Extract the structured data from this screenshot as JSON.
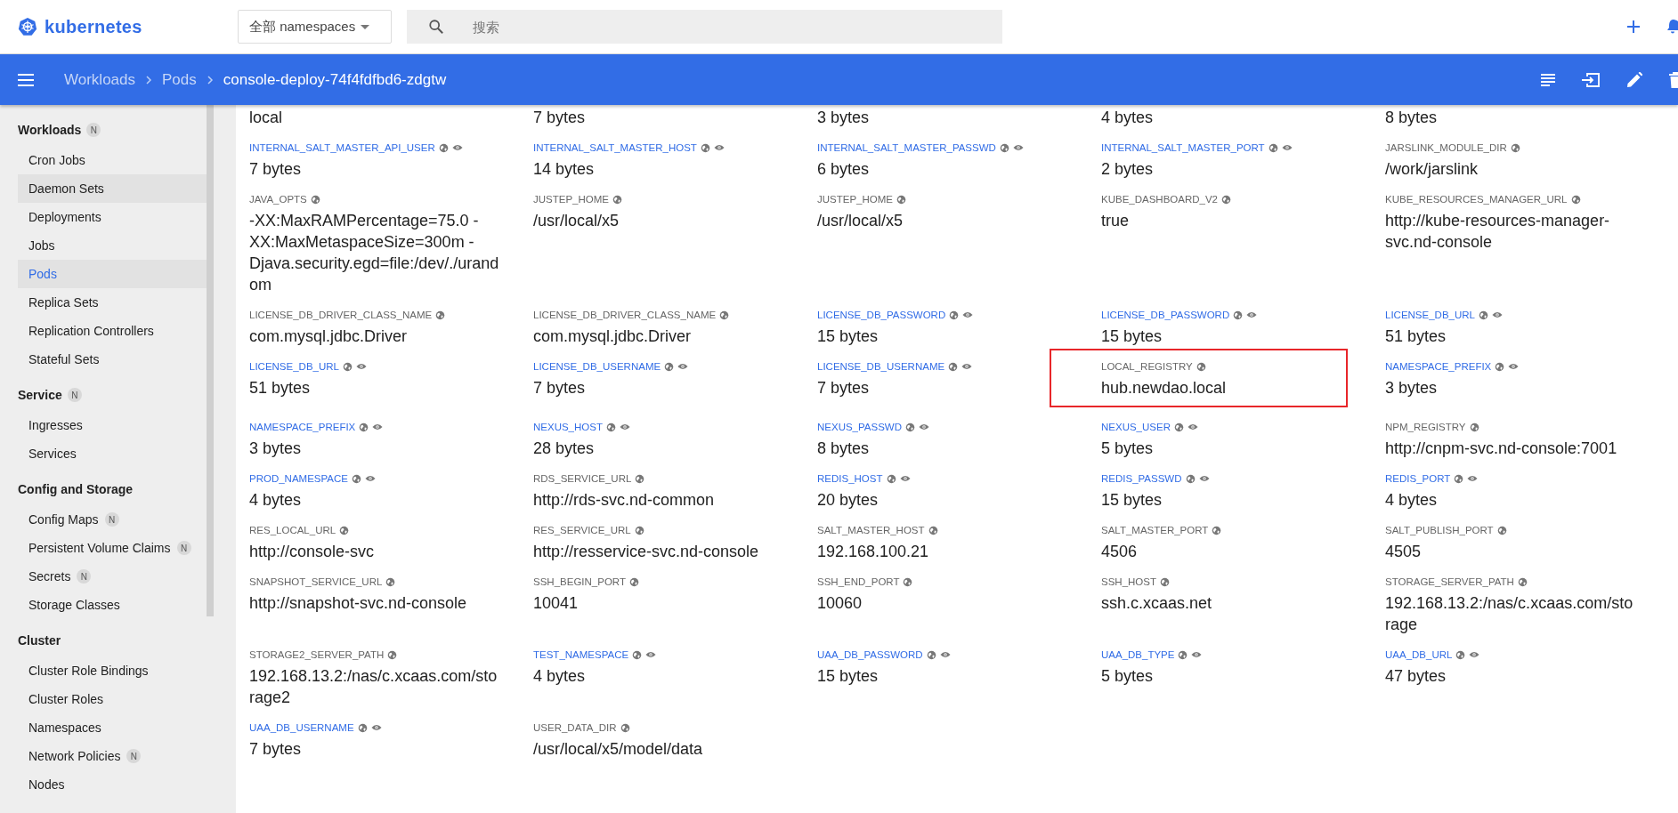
{
  "header": {
    "logo_text": "kubernetes",
    "namespace_select": "全部 namespaces",
    "search": {
      "placeholder": "搜索"
    }
  },
  "action_bar": {
    "breadcrumbs": [
      {
        "label": "Workloads",
        "current": false
      },
      {
        "label": "Pods",
        "current": false
      },
      {
        "label": "console-deploy-74f4fdfbd6-zdgtw",
        "current": true
      }
    ]
  },
  "sidebar": {
    "sections": [
      {
        "title": "Workloads",
        "badge": "N",
        "items": [
          {
            "label": "Cron Jobs",
            "selected": false,
            "hovered": false
          },
          {
            "label": "Daemon Sets",
            "selected": false,
            "hovered": true
          },
          {
            "label": "Deployments",
            "selected": false,
            "hovered": false
          },
          {
            "label": "Jobs",
            "selected": false,
            "hovered": false
          },
          {
            "label": "Pods",
            "selected": true,
            "hovered": false
          },
          {
            "label": "Replica Sets",
            "selected": false,
            "hovered": false
          },
          {
            "label": "Replication Controllers",
            "selected": false,
            "hovered": false
          },
          {
            "label": "Stateful Sets",
            "selected": false,
            "hovered": false
          }
        ]
      },
      {
        "title": "Service",
        "badge": "N",
        "items": [
          {
            "label": "Ingresses",
            "selected": false,
            "hovered": false
          },
          {
            "label": "Services",
            "selected": false,
            "hovered": false
          }
        ]
      },
      {
        "title": "Config and Storage",
        "items": [
          {
            "label": "Config Maps",
            "badge": "N",
            "selected": false,
            "hovered": false
          },
          {
            "label": "Persistent Volume Claims",
            "badge": "N",
            "selected": false,
            "hovered": false
          },
          {
            "label": "Secrets",
            "badge": "N",
            "selected": false,
            "hovered": false
          },
          {
            "label": "Storage Classes",
            "selected": false,
            "hovered": false
          }
        ]
      },
      {
        "title": "Cluster",
        "items": [
          {
            "label": "Cluster Role Bindings",
            "selected": false,
            "hovered": false
          },
          {
            "label": "Cluster Roles",
            "selected": false,
            "hovered": false
          },
          {
            "label": "Namespaces",
            "selected": false,
            "hovered": false
          },
          {
            "label": "Network Policies",
            "badge": "N",
            "selected": false,
            "hovered": false
          },
          {
            "label": "Nodes",
            "selected": false,
            "hovered": false
          }
        ]
      }
    ]
  },
  "env_vars": [
    {
      "value": "local"
    },
    {
      "value": "7 bytes"
    },
    {
      "value": "3 bytes"
    },
    {
      "value": "4 bytes"
    },
    {
      "value": "8 bytes"
    },
    {
      "kind": "secret",
      "key": "INTERNAL_SALT_MASTER_API_USER",
      "value": "7 bytes"
    },
    {
      "kind": "secret",
      "key": "INTERNAL_SALT_MASTER_HOST",
      "value": "14 bytes"
    },
    {
      "kind": "secret",
      "key": "INTERNAL_SALT_MASTER_PASSWD",
      "value": "6 bytes"
    },
    {
      "kind": "secret",
      "key": "INTERNAL_SALT_MASTER_PORT",
      "value": "2 bytes"
    },
    {
      "kind": "config",
      "key": "JARSLINK_MODULE_DIR",
      "value": "/work/jarslink"
    },
    {
      "kind": "config",
      "key": "JAVA_OPTS",
      "value": "-XX:MaxRAMPercentage=75.0 -XX:MaxMetaspaceSize=300m -Djava.security.egd=file:/dev/./urandom"
    },
    {
      "kind": "config",
      "key": "JUSTEP_HOME",
      "value": "/usr/local/x5"
    },
    {
      "kind": "config",
      "key": "JUSTEP_HOME",
      "value": "/usr/local/x5"
    },
    {
      "kind": "config",
      "key": "KUBE_DASHBOARD_V2",
      "value": "true"
    },
    {
      "kind": "config",
      "key": "KUBE_RESOURCES_MANAGER_URL",
      "value": "http://kube-resources-manager-svc.nd-console"
    },
    {
      "kind": "config",
      "key": "LICENSE_DB_DRIVER_CLASS_NAME",
      "value": "com.mysql.jdbc.Driver"
    },
    {
      "kind": "config",
      "key": "LICENSE_DB_DRIVER_CLASS_NAME",
      "value": "com.mysql.jdbc.Driver"
    },
    {
      "kind": "secret",
      "key": "LICENSE_DB_PASSWORD",
      "value": "15 bytes"
    },
    {
      "kind": "secret",
      "key": "LICENSE_DB_PASSWORD",
      "value": "15 bytes"
    },
    {
      "kind": "secret",
      "key": "LICENSE_DB_URL",
      "value": "51 bytes"
    },
    {
      "kind": "secret",
      "key": "LICENSE_DB_URL",
      "value": "51 bytes"
    },
    {
      "kind": "secret",
      "key": "LICENSE_DB_USERNAME",
      "value": "7 bytes"
    },
    {
      "kind": "secret",
      "key": "LICENSE_DB_USERNAME",
      "value": "7 bytes"
    },
    {
      "kind": "config",
      "key": "LOCAL_REGISTRY",
      "value": "hub.newdao.local",
      "highlighted": true
    },
    {
      "kind": "secret",
      "key": "NAMESPACE_PREFIX",
      "value": "3 bytes"
    },
    {
      "kind": "secret",
      "key": "NAMESPACE_PREFIX",
      "value": "3 bytes"
    },
    {
      "kind": "secret",
      "key": "NEXUS_HOST",
      "value": "28 bytes"
    },
    {
      "kind": "secret",
      "key": "NEXUS_PASSWD",
      "value": "8 bytes"
    },
    {
      "kind": "secret",
      "key": "NEXUS_USER",
      "value": "5 bytes"
    },
    {
      "kind": "config",
      "key": "NPM_REGISTRY",
      "value": "http://cnpm-svc.nd-console:7001"
    },
    {
      "kind": "secret",
      "key": "PROD_NAMESPACE",
      "value": "4 bytes"
    },
    {
      "kind": "config",
      "key": "RDS_SERVICE_URL",
      "value": "http://rds-svc.nd-common"
    },
    {
      "kind": "secret",
      "key": "REDIS_HOST",
      "value": "20 bytes"
    },
    {
      "kind": "secret",
      "key": "REDIS_PASSWD",
      "value": "15 bytes"
    },
    {
      "kind": "secret",
      "key": "REDIS_PORT",
      "value": "4 bytes"
    },
    {
      "kind": "config",
      "key": "RES_LOCAL_URL",
      "value": "http://console-svc"
    },
    {
      "kind": "config",
      "key": "RES_SERVICE_URL",
      "value": "http://resservice-svc.nd-console"
    },
    {
      "kind": "config",
      "key": "SALT_MASTER_HOST",
      "value": "192.168.100.21"
    },
    {
      "kind": "config",
      "key": "SALT_MASTER_PORT",
      "value": "4506"
    },
    {
      "kind": "config",
      "key": "SALT_PUBLISH_PORT",
      "value": "4505"
    },
    {
      "kind": "config",
      "key": "SNAPSHOT_SERVICE_URL",
      "value": "http://snapshot-svc.nd-console"
    },
    {
      "kind": "config",
      "key": "SSH_BEGIN_PORT",
      "value": "10041"
    },
    {
      "kind": "config",
      "key": "SSH_END_PORT",
      "value": "10060"
    },
    {
      "kind": "config",
      "key": "SSH_HOST",
      "value": "ssh.c.xcaas.net"
    },
    {
      "kind": "config",
      "key": "STORAGE_SERVER_PATH",
      "value": "192.168.13.2:/nas/c.xcaas.com/storage"
    },
    {
      "kind": "config",
      "key": "STORAGE2_SERVER_PATH",
      "value": "192.168.13.2:/nas/c.xcaas.com/storage2"
    },
    {
      "kind": "secret",
      "key": "TEST_NAMESPACE",
      "value": "4 bytes"
    },
    {
      "kind": "secret",
      "key": "UAA_DB_PASSWORD",
      "value": "15 bytes"
    },
    {
      "kind": "secret",
      "key": "UAA_DB_TYPE",
      "value": "5 bytes"
    },
    {
      "kind": "secret",
      "key": "UAA_DB_URL",
      "value": "47 bytes"
    },
    {
      "kind": "secret",
      "key": "UAA_DB_USERNAME",
      "value": "7 bytes"
    },
    {
      "kind": "config",
      "key": "USER_DATA_DIR",
      "value": "/usr/local/x5/model/data"
    }
  ]
}
